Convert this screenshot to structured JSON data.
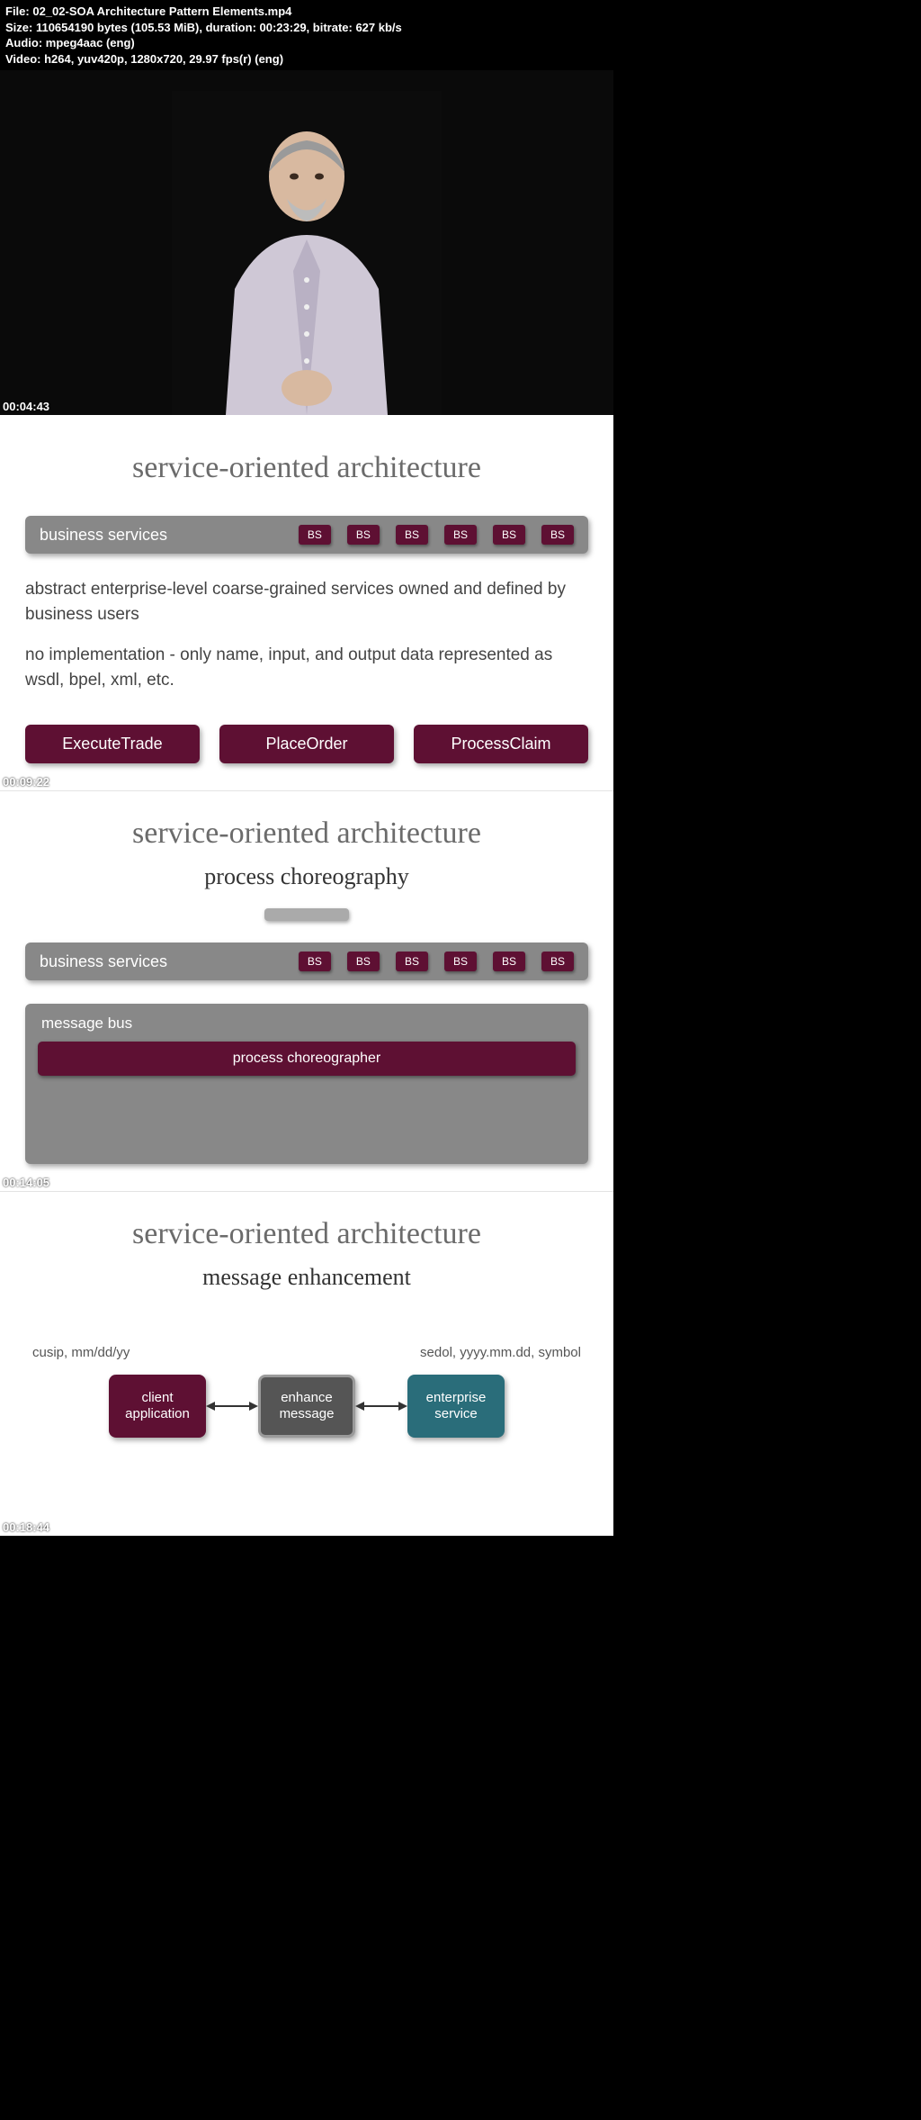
{
  "meta": {
    "file": "File: 02_02-SOA Architecture Pattern Elements.mp4",
    "size": "Size: 110654190 bytes (105.53 MiB), duration: 00:23:29, bitrate: 627 kb/s",
    "audio": "Audio: mpeg4aac (eng)",
    "video": "Video: h264, yuv420p, 1280x720, 29.97 fps(r) (eng)"
  },
  "timestamps": {
    "t1": "00:04:43",
    "t2": "00:09:22",
    "t3": "00:14:05",
    "t4": "00:18:44"
  },
  "slide1": {
    "title": "service-oriented architecture",
    "biz_label": "business services",
    "bs": "BS",
    "desc1": "abstract enterprise-level coarse-grained services owned and defined by business users",
    "desc2": "no implementation - only name, input, and output data represented as wsdl, bpel, xml, etc.",
    "btn1": "ExecuteTrade",
    "btn2": "PlaceOrder",
    "btn3": "ProcessClaim"
  },
  "slide2": {
    "title": "service-oriented architecture",
    "subtitle": "process choreography",
    "biz_label": "business services",
    "bs": "BS",
    "msgbus": "message bus",
    "choreo": "process choreographer"
  },
  "slide3": {
    "title": "service-oriented architecture",
    "subtitle": "message enhancement",
    "left_hint": "cusip, mm/dd/yy",
    "right_hint": "sedol, yyyy.mm.dd, symbol",
    "box1": "client application",
    "box2": "enhance message",
    "box3": "enterprise service"
  }
}
